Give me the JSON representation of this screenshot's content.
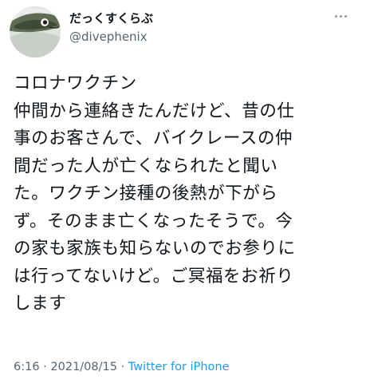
{
  "tweet": {
    "display_name": "だっくすくらぶ",
    "handle": "@divephenix",
    "more_icon": "more-horizontal-icon",
    "text": "コロナワクチン\n仲間から連絡きたんだけど、昔の仕\n事のお客さんで、バイクレースの仲\n間だった人が亡くなられたと聞い\nた。ワクチン接種の後熱が下がら\nず。そのまま亡くなったそうで。今\nの家も家族も知らないのでお参りに\nは行ってないけど。ご冥福をお祈り\nします",
    "time": "6:16",
    "separator_1": " · ",
    "date": "2021/08/15",
    "separator_2": " · ",
    "source": "Twitter for iPhone"
  },
  "colors": {
    "text_primary": "#0f1419",
    "text_secondary": "#536471",
    "link": "#1d9bf0",
    "background": "#ffffff"
  }
}
